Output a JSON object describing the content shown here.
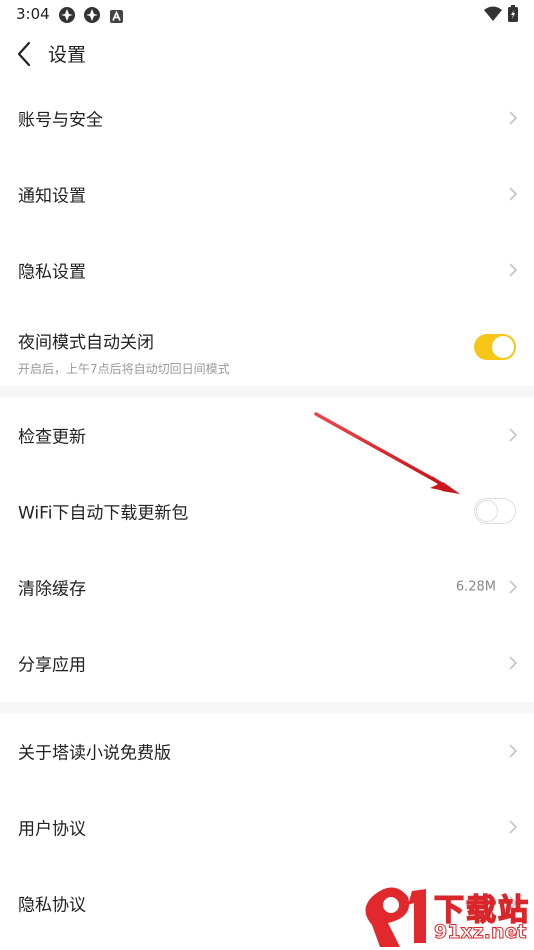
{
  "status_bar": {
    "time": "3:04",
    "icons": [
      "app-icon-1",
      "app-icon-2",
      "a-notification-icon",
      "wifi-icon",
      "battery-icon"
    ]
  },
  "nav": {
    "title": "设置",
    "back_icon": "chevron-left-icon"
  },
  "sections": [
    [
      {
        "label": "账号与安全",
        "type": "link"
      },
      {
        "label": "通知设置",
        "type": "link"
      },
      {
        "label": "隐私设置",
        "type": "link"
      },
      {
        "label": "夜间模式自动关闭",
        "subtitle": "开启后，上午7点后将自动切回日间模式",
        "type": "toggle",
        "on": true
      }
    ],
    [
      {
        "label": "检查更新",
        "type": "link"
      },
      {
        "label": "WiFi下自动下载更新包",
        "type": "toggle",
        "on": false
      },
      {
        "label": "清除缓存",
        "value": "6.28M",
        "type": "link"
      },
      {
        "label": "分享应用",
        "type": "link"
      }
    ],
    [
      {
        "label": "关于塔读小说免费版",
        "type": "link"
      },
      {
        "label": "用户协议",
        "type": "link"
      },
      {
        "label": "隐私协议",
        "type": "link"
      }
    ]
  ],
  "colors": {
    "accent": "#f5c518",
    "annotation_arrow": "#d8262b",
    "section_gap": "#f6f6f6",
    "subtitle": "#999999"
  },
  "watermark": {
    "text": "下载站",
    "url": "91xz.net"
  }
}
